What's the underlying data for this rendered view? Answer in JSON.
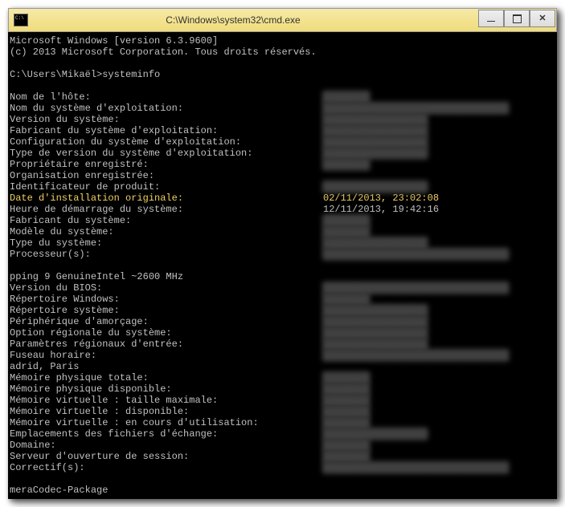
{
  "window": {
    "title": "C:\\Windows\\system32\\cmd.exe"
  },
  "header": {
    "line1": "Microsoft Windows [version 6.3.9600]",
    "line2": "(c) 2013 Microsoft Corporation. Tous droits réservés."
  },
  "prompt": {
    "path": "C:\\Users\\Mikaël>",
    "command": "systeminfo"
  },
  "info": {
    "host_label": "Nom de l'hôte:",
    "os_label": "Nom du système d'exploitation:",
    "version_label": "Version du système:",
    "manufacturer_label": "Fabricant du système d'exploitation:",
    "config_label": "Configuration du système d'exploitation:",
    "build_label": "Type de version du système d'exploitation:",
    "owner_label": "Propriétaire enregistré:",
    "org_label": "Organisation enregistrée:",
    "product_id_label": "Identificateur de produit:",
    "install_date_label": "Date d'installation originale:",
    "install_date_value": "02/11/2013, 23:02:08",
    "boot_time_label": "Heure de démarrage du système:",
    "boot_time_value": "12/11/2013, 19:42:16",
    "sys_manufacturer_label": "Fabricant du système:",
    "sys_model_label": "Modèle du système:",
    "sys_type_label": "Type du système:",
    "processors_label": "Processeur(s):",
    "processor_detail": "pping 9 GenuineIntel ~2600 MHz",
    "bios_label": "Version du BIOS:",
    "windir_label": "Répertoire Windows:",
    "sysdir_label": "Répertoire système:",
    "boot_device_label": "Périphérique d'amorçage:",
    "locale_label": "Option régionale du système:",
    "input_locale_label": "Paramètres régionaux d'entrée:",
    "timezone_label": "Fuseau horaire:",
    "timezone_detail": "adrid, Paris",
    "mem_total_label": "Mémoire physique totale:",
    "mem_avail_label": "Mémoire physique disponible:",
    "vmem_max_label": "Mémoire virtuelle : taille maximale:",
    "vmem_avail_label": "Mémoire virtuelle : disponible:",
    "vmem_used_label": "Mémoire virtuelle : en cours d'utilisation:",
    "pagefile_label": "Emplacements des fichiers d'échange:",
    "domain_label": "Domaine:",
    "logon_server_label": "Serveur d'ouverture de session:",
    "hotfix_label": "Correctif(s):",
    "footer": "meraCodec-Package"
  },
  "blurred_placeholders": {
    "short": "████████",
    "medium": "██████████████████",
    "long": "████████████████████████████████"
  }
}
